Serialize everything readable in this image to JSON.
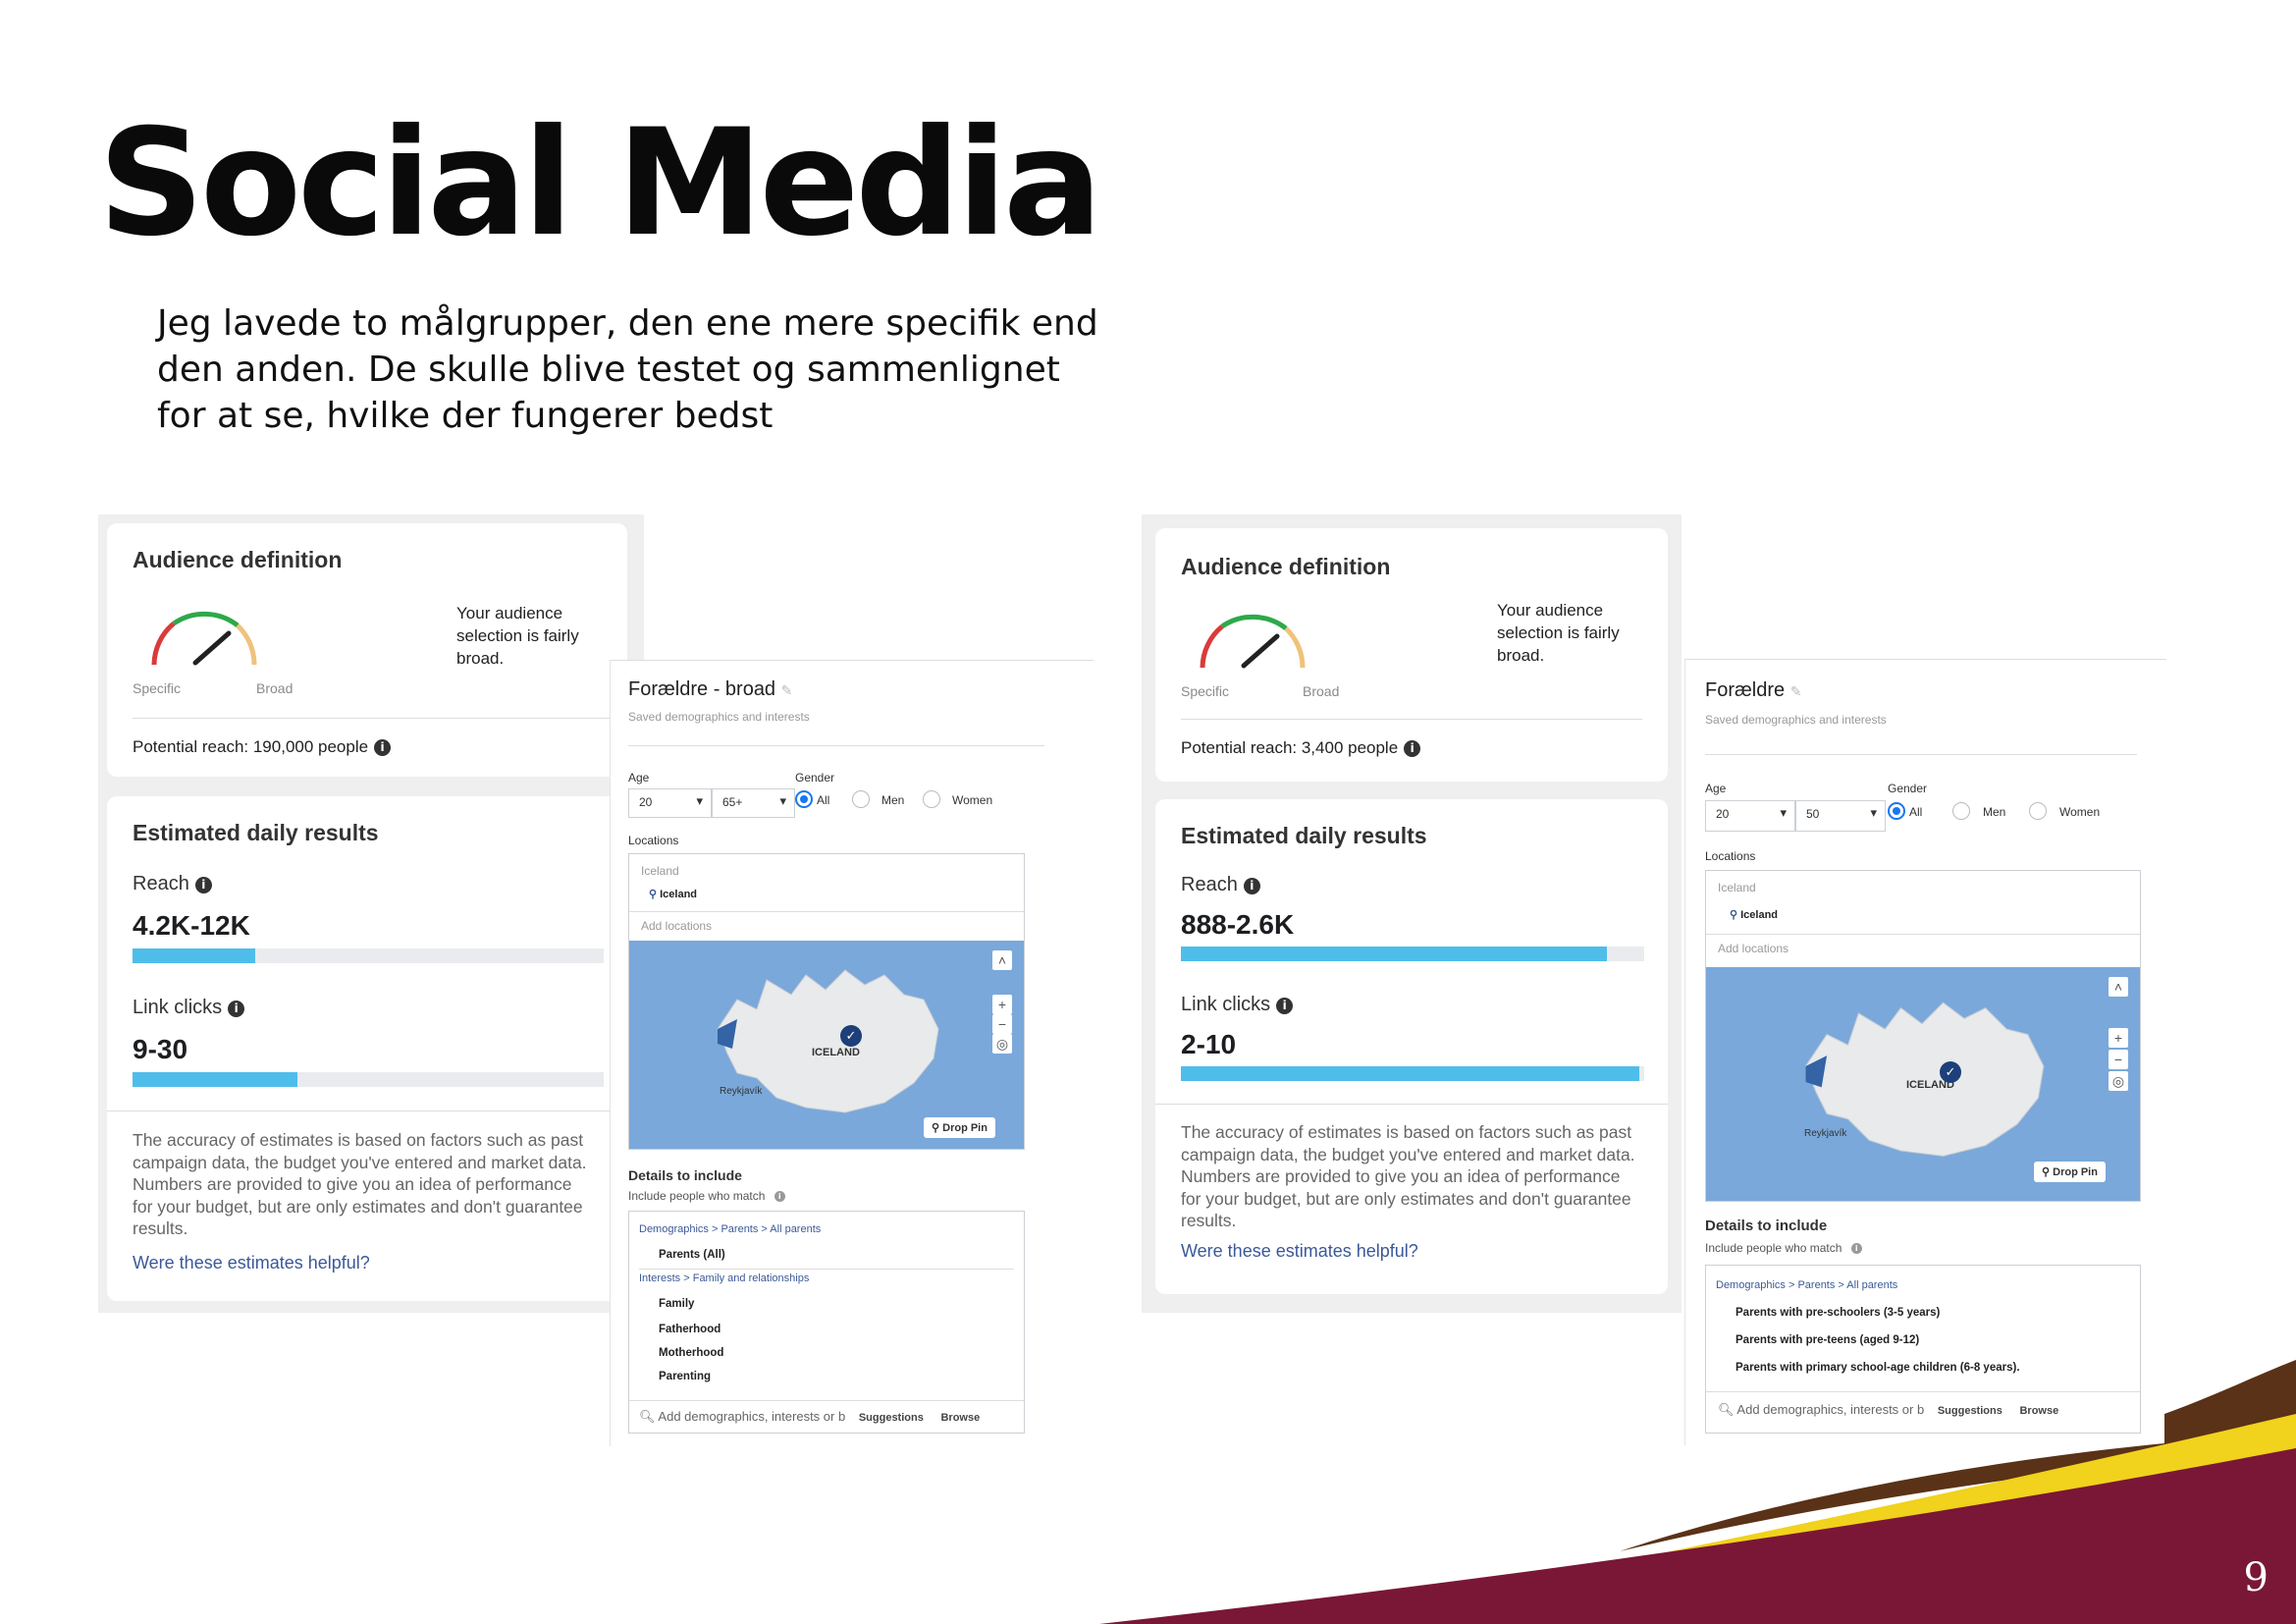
{
  "slide": {
    "title": "Social Media",
    "intro_lines": [
      "Jeg lavede to målgrupper, den ene mere specifik end",
      "den anden. De skulle blive testet og sammenlignet",
      "for at se, hvilke der fungerer bedst"
    ],
    "page_number": "9"
  },
  "colors": {
    "gauge_red": "#d93b3b",
    "gauge_green": "#2ea84a",
    "gauge_yellow": "#f0c27b",
    "bar_fill": "#4fbdea",
    "bar_track": "#e9ebee",
    "footer_maroon": "#7a1736",
    "footer_yellow": "#f1d21c",
    "footer_brown": "#5a3217"
  },
  "left": {
    "audience": {
      "title": "Audience definition",
      "message": [
        "Your audience",
        "selection is fairly",
        "broad."
      ],
      "gauge_specific": "Specific",
      "gauge_broad": "Broad",
      "potential_reach": "Potential reach: 190,000 people"
    },
    "estimated": {
      "title": "Estimated daily results",
      "reach_label": "Reach",
      "reach_value": "4.2K-12K",
      "reach_fill": 0.26,
      "clicks_label": "Link clicks",
      "clicks_value": "9-30",
      "clicks_fill": 0.35,
      "disclaimer": [
        "The accuracy of estimates is based on factors such as past",
        "campaign data, the budget you've entered and market data.",
        "Numbers are provided to give you an idea of performance",
        "for your budget, but are only estimates and don't guarantee",
        "results."
      ],
      "helpful_link": "Were these estimates helpful?"
    },
    "form": {
      "name": "Forældre - broad",
      "saved": "Saved demographics and interests",
      "age_label": "Age",
      "age_min": "20",
      "age_max": "65+",
      "gender_label": "Gender",
      "gender_all": "All",
      "gender_men": "Men",
      "gender_women": "Women",
      "locations_label": "Locations",
      "loc_country": "Iceland",
      "loc_item": "Iceland",
      "add_locations": "Add locations",
      "map_label": "ICELAND",
      "map_city": "Reykjavík",
      "drop_pin": "Drop Pin",
      "details_title": "Details to include",
      "include_text": "Include people who match",
      "crumb1": "Demographics > Parents > All parents",
      "tag1": "Parents (All)",
      "crumb2": "Interests > Family and relationships",
      "tags2": [
        "Family",
        "Fatherhood",
        "Motherhood",
        "Parenting"
      ],
      "search_placeholder": "Add demographics, interests or b",
      "suggestions": "Suggestions",
      "browse": "Browse"
    }
  },
  "right": {
    "audience": {
      "title": "Audience definition",
      "message": [
        "Your audience",
        "selection is fairly",
        "broad."
      ],
      "gauge_specific": "Specific",
      "gauge_broad": "Broad",
      "potential_reach": "Potential reach: 3,400 people"
    },
    "estimated": {
      "title": "Estimated daily results",
      "reach_label": "Reach",
      "reach_value": "888-2.6K",
      "reach_fill": 0.92,
      "clicks_label": "Link clicks",
      "clicks_value": "2-10",
      "clicks_fill": 0.99,
      "disclaimer": [
        "The accuracy of estimates is based on factors such as past",
        "campaign data, the budget you've entered and market data.",
        "Numbers are provided to give you an idea of performance",
        "for your budget, but are only estimates and don't guarantee",
        "results."
      ],
      "helpful_link": "Were these estimates helpful?"
    },
    "form": {
      "name": "Forældre",
      "saved": "Saved demographics and interests",
      "age_label": "Age",
      "age_min": "20",
      "age_max": "50",
      "gender_label": "Gender",
      "gender_all": "All",
      "gender_men": "Men",
      "gender_women": "Women",
      "locations_label": "Locations",
      "loc_country": "Iceland",
      "loc_item": "Iceland",
      "add_locations": "Add locations",
      "map_label": "ICELAND",
      "map_city": "Reykjavík",
      "drop_pin": "Drop Pin",
      "details_title": "Details to include",
      "include_text": "Include people who match",
      "crumb1": "Demographics > Parents > All parents",
      "tags1": [
        "Parents with pre-schoolers (3-5 years)",
        "Parents with pre-teens (aged 9-12)",
        "Parents with primary school-age children (6-8 years)."
      ],
      "search_placeholder": "Add demographics, interests or b",
      "suggestions": "Suggestions",
      "browse": "Browse"
    }
  }
}
